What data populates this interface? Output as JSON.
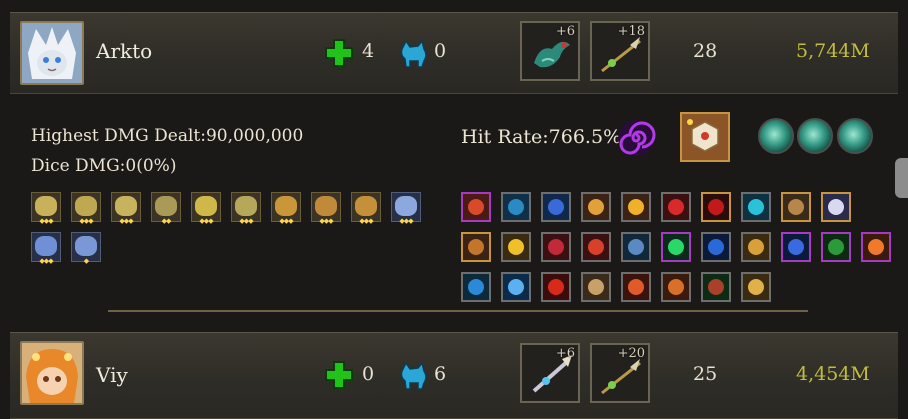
{
  "players": [
    {
      "name": "Arkto",
      "heal": "4",
      "pet": "0",
      "equip": [
        "+6",
        "+18"
      ],
      "level": "28",
      "power": "5,744M"
    },
    {
      "name": "Viy",
      "heal": "0",
      "pet": "6",
      "equip": [
        "+6",
        "+20"
      ],
      "level": "25",
      "power": "4,454M"
    }
  ],
  "details": {
    "highest_dmg": "Highest DMG Dealt:90,000,000",
    "dice_dmg": "Dice DMG:0(0%)",
    "hit_rate": "Hit Rate:766.5%"
  },
  "icons": {
    "heal": "green-cross-icon",
    "pet": "blue-pet-icon",
    "swirl": "purple-swirl-icon"
  },
  "colors": {
    "power": "#c3bd3c",
    "heal": "#21c21a",
    "pet": "#2aa7d6",
    "swirl": "#a22bd6"
  }
}
